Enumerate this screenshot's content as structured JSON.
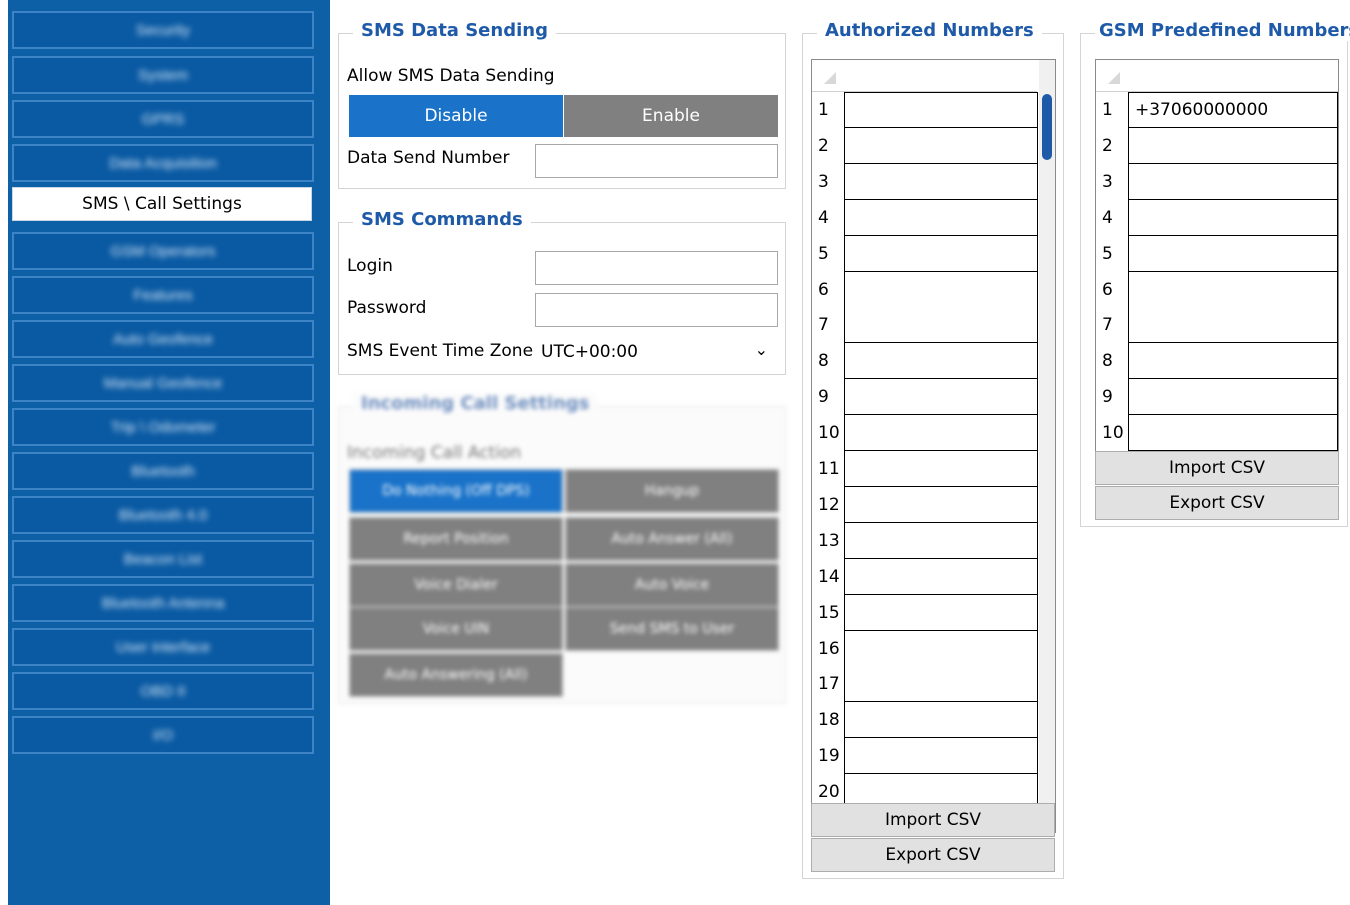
{
  "sidebar": {
    "items": [
      {
        "label": "Security"
      },
      {
        "label": "System"
      },
      {
        "label": "GPRS"
      },
      {
        "label": "Data Acquisition"
      },
      {
        "label": "SMS \\ Call Settings",
        "active": true
      },
      {
        "label": "GSM Operators"
      },
      {
        "label": "Features"
      },
      {
        "label": "Auto Geofence"
      },
      {
        "label": "Manual Geofence"
      },
      {
        "label": "Trip \\ Odometer"
      },
      {
        "label": "Bluetooth"
      },
      {
        "label": "Bluetooth 4.0"
      },
      {
        "label": "Beacon List"
      },
      {
        "label": "Bluetooth Antenna"
      },
      {
        "label": "User Interface"
      },
      {
        "label": "OBD II"
      },
      {
        "label": "I/O"
      }
    ]
  },
  "sms_data_sending": {
    "title": "SMS Data Sending",
    "allow_label": "Allow SMS Data Sending",
    "disable_label": "Disable",
    "enable_label": "Enable",
    "selected": "Disable",
    "data_send_number_label": "Data Send Number",
    "data_send_number_value": ""
  },
  "sms_commands": {
    "title": "SMS Commands",
    "login_label": "Login",
    "login_value": "",
    "password_label": "Password",
    "password_value": "",
    "timezone_label": "SMS Event Time Zone",
    "timezone_value": "UTC+00:00"
  },
  "roaming": {
    "title": "Incoming Call Settings",
    "sub_label": "Incoming Call Action",
    "buttons": [
      {
        "label": "Do Nothing (Off DPS)",
        "active": true
      },
      {
        "label": "Hangup",
        "active": false
      },
      {
        "label": "Report Position",
        "active": false
      },
      {
        "label": "Auto Answer (All)",
        "active": false
      },
      {
        "label": "Voice Dialer",
        "active": false
      },
      {
        "label": "Auto Voice",
        "active": false
      },
      {
        "label": "Voice UIN",
        "active": false
      },
      {
        "label": "Send SMS to User",
        "active": false
      },
      {
        "label": "Auto Answering (All)",
        "active": false
      }
    ]
  },
  "authorized_numbers": {
    "title": "Authorized Numbers",
    "rows": [
      {
        "idx": "1",
        "value": ""
      },
      {
        "idx": "2",
        "value": ""
      },
      {
        "idx": "3",
        "value": ""
      },
      {
        "idx": "4",
        "value": ""
      },
      {
        "idx": "5",
        "value": ""
      },
      {
        "idx": "6",
        "value": ""
      },
      {
        "idx": "7",
        "value": ""
      },
      {
        "idx": "8",
        "value": ""
      },
      {
        "idx": "9",
        "value": ""
      },
      {
        "idx": "10",
        "value": ""
      },
      {
        "idx": "11",
        "value": ""
      },
      {
        "idx": "12",
        "value": ""
      },
      {
        "idx": "13",
        "value": ""
      },
      {
        "idx": "14",
        "value": ""
      },
      {
        "idx": "15",
        "value": ""
      },
      {
        "idx": "16",
        "value": ""
      },
      {
        "idx": "17",
        "value": ""
      },
      {
        "idx": "18",
        "value": ""
      },
      {
        "idx": "19",
        "value": ""
      },
      {
        "idx": "20",
        "value": ""
      }
    ],
    "import_label": "Import CSV",
    "export_label": "Export CSV"
  },
  "gsm_predefined": {
    "title": "GSM Predefined Numbers",
    "rows": [
      {
        "idx": "1",
        "value": "+37060000000"
      },
      {
        "idx": "2",
        "value": ""
      },
      {
        "idx": "3",
        "value": ""
      },
      {
        "idx": "4",
        "value": ""
      },
      {
        "idx": "5",
        "value": ""
      },
      {
        "idx": "6",
        "value": ""
      },
      {
        "idx": "7",
        "value": ""
      },
      {
        "idx": "8",
        "value": ""
      },
      {
        "idx": "9",
        "value": ""
      },
      {
        "idx": "10",
        "value": ""
      }
    ],
    "import_label": "Import CSV",
    "export_label": "Export CSV"
  },
  "colors": {
    "sidebar_bg": "#0d5fa6",
    "accent": "#1a73c9",
    "title_blue": "#1e5aa8",
    "button_gray": "#808080"
  }
}
